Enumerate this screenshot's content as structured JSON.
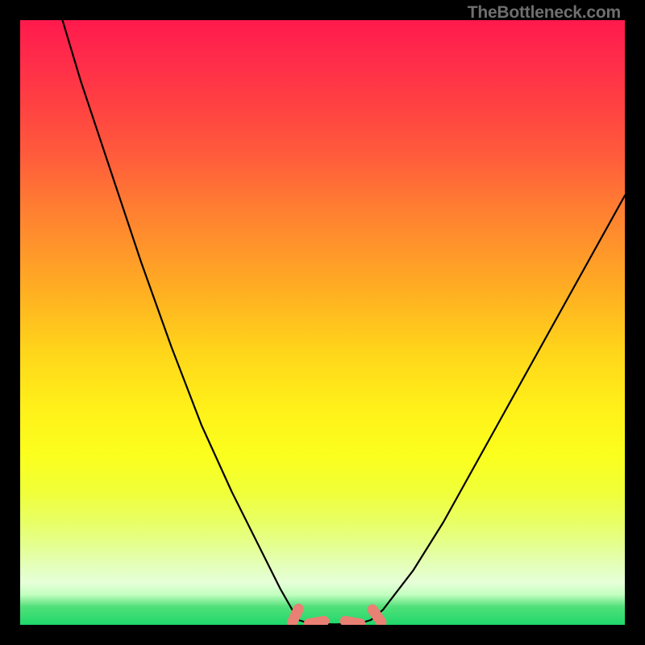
{
  "watermark": "TheBottleneck.com",
  "colors": {
    "frame": "#000000",
    "curve": "#000000",
    "marker": "#e98074",
    "gradient_top": "#ff1a4d",
    "gradient_bottom": "#1fd86a"
  },
  "chart_data": {
    "type": "line",
    "title": "",
    "xlabel": "",
    "ylabel": "",
    "xlim": [
      0,
      100
    ],
    "ylim": [
      0,
      100
    ],
    "grid": false,
    "legend": false,
    "annotations": [
      "TheBottleneck.com"
    ],
    "series": [
      {
        "name": "bottleneck-curve-left",
        "x": [
          7,
          10,
          15,
          20,
          25,
          30,
          35,
          40,
          43,
          45,
          46
        ],
        "y": [
          100,
          90,
          75,
          60,
          46,
          33,
          22,
          12,
          6,
          2.5,
          0.8
        ]
      },
      {
        "name": "bottleneck-curve-bottom",
        "x": [
          46,
          48,
          52,
          56,
          58
        ],
        "y": [
          0.8,
          0.2,
          0.1,
          0.2,
          0.8
        ]
      },
      {
        "name": "bottleneck-curve-right",
        "x": [
          58,
          60,
          65,
          70,
          75,
          80,
          85,
          90,
          95,
          100
        ],
        "y": [
          0.8,
          2.5,
          9,
          17,
          26,
          35,
          44,
          53,
          62,
          71
        ]
      }
    ],
    "markers": [
      {
        "name": "left-foot",
        "cx": 45.5,
        "cy": 1.5,
        "angle_deg": -65
      },
      {
        "name": "mid-left",
        "cx": 49,
        "cy": 0.4,
        "angle_deg": -10
      },
      {
        "name": "mid-right",
        "cx": 55,
        "cy": 0.4,
        "angle_deg": 10
      },
      {
        "name": "right-foot",
        "cx": 59,
        "cy": 1.5,
        "angle_deg": 55
      }
    ]
  }
}
